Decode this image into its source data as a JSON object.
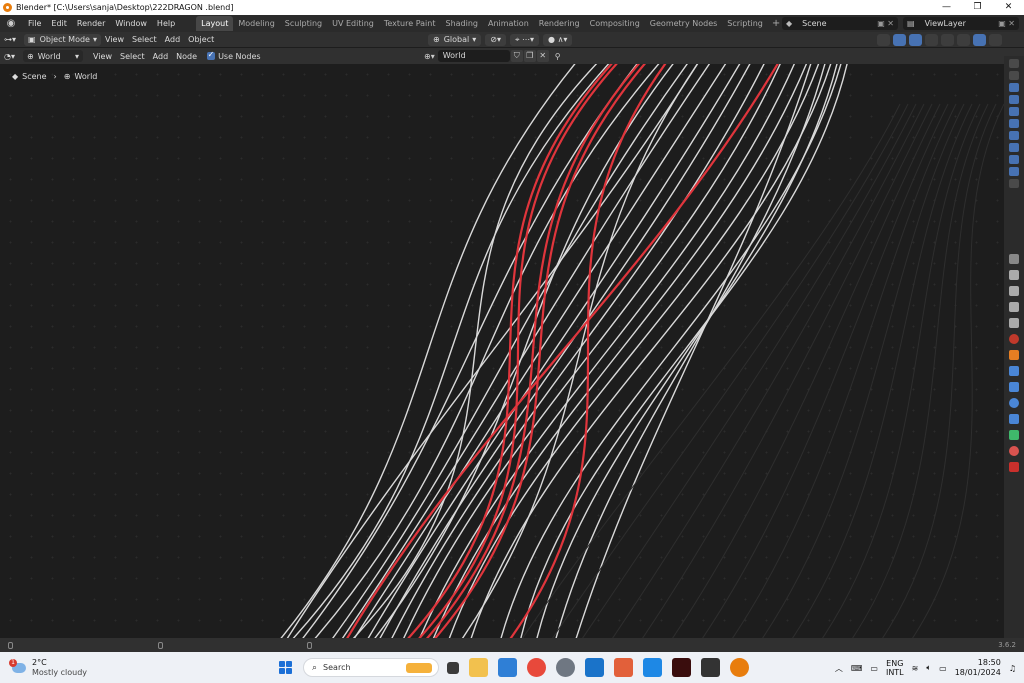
{
  "window": {
    "title": "Blender* [C:\\Users\\sanja\\Desktop\\222DRAGON .blend]",
    "minimize": "—",
    "maximize": "❐",
    "close": "✕"
  },
  "menu": [
    "File",
    "Edit",
    "Render",
    "Window",
    "Help"
  ],
  "workspaces": [
    "Layout",
    "Modeling",
    "Sculpting",
    "UV Editing",
    "Texture Paint",
    "Shading",
    "Animation",
    "Rendering",
    "Compositing",
    "Geometry Nodes",
    "Scripting"
  ],
  "workspace_add": "+",
  "scene": {
    "label": "Scene"
  },
  "view_layer": {
    "label": "ViewLayer"
  },
  "header1": {
    "mode": "Object Mode",
    "items": [
      "View",
      "Select",
      "Add",
      "Object"
    ],
    "orientation": "Global"
  },
  "header2": {
    "shader_type": "World",
    "items": [
      "View",
      "Select",
      "Add",
      "Node"
    ],
    "use_nodes": "Use Nodes",
    "world_name": "World"
  },
  "breadcrumb": {
    "scene": "Scene",
    "world": "World"
  },
  "status": {
    "version": "3.6.2"
  },
  "taskbar": {
    "weather_temp": "2°C",
    "weather_desc": "Mostly cloudy",
    "weather_badge": "1",
    "search_placeholder": "Search",
    "lang_1": "ENG",
    "lang_2": "INTL",
    "time": "18:50",
    "date": "18/01/2024"
  },
  "colors": {
    "accent": "#4772b3",
    "link_white": "#d9d9d9",
    "link_red": "#e0353c"
  }
}
